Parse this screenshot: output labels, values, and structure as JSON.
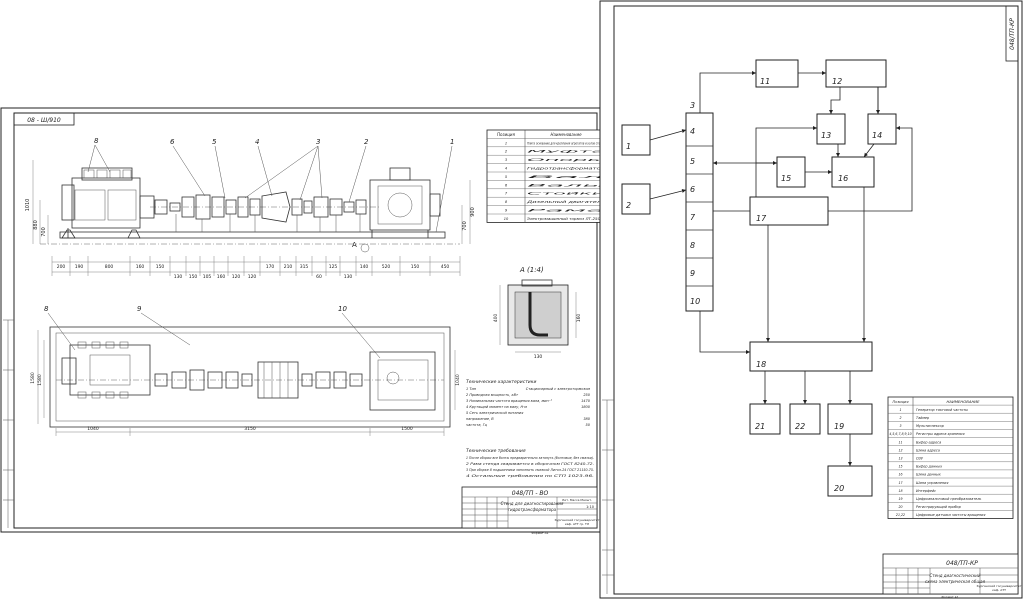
{
  "left_sheet": {
    "stamp_code": "08 - Ш/910",
    "callouts": [
      "1",
      "2",
      "3",
      "4",
      "5",
      "6",
      "7"
    ],
    "plan_callouts": [
      "8",
      "9",
      "10"
    ],
    "section_title": "А (1:4)",
    "section_mark": "А",
    "dims_top": [
      "1010",
      "900",
      "880",
      "700"
    ],
    "dims_bottom": [
      "200",
      "190",
      "800",
      "160",
      "150",
      "130",
      "150",
      "105",
      "160",
      "120",
      "120",
      "170",
      "210",
      "315",
      "60",
      "125",
      "130",
      "140",
      "60",
      "170",
      "520",
      "150",
      "450"
    ],
    "dims_plan": [
      "1040",
      "3150",
      "1500",
      "1580",
      "1580"
    ],
    "section_dims": [
      "400",
      "160",
      "130"
    ],
    "parts_table": {
      "headers": [
        "Позиция",
        "Наименование"
      ],
      "rows": [
        [
          "1",
          "Плита основание для крепления агрегатов и узлов стенда"
        ],
        [
          "2",
          "Муфта"
        ],
        [
          "3",
          "Опоры"
        ],
        [
          "4",
          "Гидротрансформатор"
        ],
        [
          "5",
          "Вал"
        ],
        [
          "6",
          "Валы"
        ],
        [
          "7",
          "Стойки"
        ],
        [
          "8",
          "Дизельный двигатель"
        ],
        [
          "9",
          "Рама"
        ],
        [
          "10",
          "Электромашинный тормоз ЛТ-250 М"
        ]
      ]
    },
    "tech_title": "Технические характеристики",
    "tech_rows": [
      [
        "1 Тип",
        "Стационарный с электротормозом"
      ],
      [
        "2 Приводная мощность, кВт",
        "250"
      ],
      [
        "3 Номинальная частота вращения вала, мин⁻¹",
        "1470"
      ],
      [
        "4 Крутящий момент на валу, Н·м",
        "1800"
      ],
      [
        "5 Сеть электрической питания",
        ""
      ],
      [
        "напряжение, В",
        "380"
      ],
      [
        "частота, Гц",
        "50"
      ]
    ],
    "notes_title": "Технические требования",
    "notes": [
      "1 После сборки все болты предварительно затянуть (болтовые, без смазки).",
      "2 Рама стенда сваривается в сборочном ГОСТ 8240-72.",
      "3 При сборке 8 подшипники заполнить смазкой Литол-24 ГОСТ 21150-75.",
      "4 Остальные требования по СТП 1023-96."
    ],
    "title_block": {
      "code": "048/ТП - ВО",
      "name_line1": "Стенд для диагностирования",
      "name_line2": "гидротрансформатора",
      "sheet_info": "Лит. Масса Масшт.",
      "scale": "1:10",
      "org_line1": "Курганский госуниверситет",
      "org_line2": "каф. АТТ гр. ТЛ",
      "format": "Формат А1"
    }
  },
  "right_sheet": {
    "stamp_code": "048/ТП-КР",
    "numbered_column": [
      "3",
      "4",
      "5",
      "6",
      "7",
      "8",
      "9",
      "10"
    ],
    "boxes": [
      "1",
      "2",
      "11",
      "12",
      "13",
      "14",
      "15",
      "16",
      "17",
      "18",
      "19",
      "20",
      "21",
      "22"
    ],
    "legend": {
      "headers": [
        "Позиция",
        "НАИМЕНОВАНИЕ"
      ],
      "rows": [
        [
          "1",
          "Генератор тактовой частоты"
        ],
        [
          "2",
          "Таймер"
        ],
        [
          "3",
          "Мультиплексор"
        ],
        [
          "4,5,6,7,8,9,10",
          "Регистры адреса хранения"
        ],
        [
          "11",
          "Буфер адреса"
        ],
        [
          "12",
          "Шина адреса"
        ],
        [
          "13",
          "ОЗУ"
        ],
        [
          "15",
          "Буфер данных"
        ],
        [
          "16",
          "Шина данных"
        ],
        [
          "17",
          "Шина управления"
        ],
        [
          "18",
          "Интерфейс"
        ],
        [
          "19",
          "Цифроаналоговый преобразователь"
        ],
        [
          "20",
          "Регистрирующий прибор"
        ],
        [
          "21,22",
          "Цифровые датчики частоты вращения"
        ]
      ]
    },
    "title_block": {
      "code": "048/ТП-КР",
      "name_line1": "Стенд диагностический",
      "name_line2": "схема электрическая общая",
      "org_line1": "Курганский госуниверситет",
      "org_line2": "каф. АТТ",
      "format": "Формат А1"
    }
  }
}
